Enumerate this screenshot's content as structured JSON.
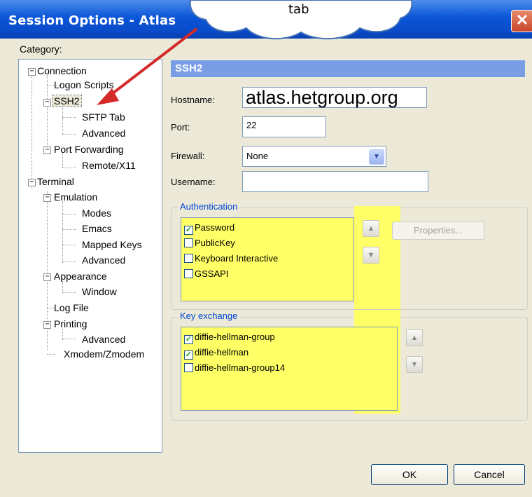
{
  "window": {
    "title": "Session Options - Atlas",
    "close_glyph": "✕"
  },
  "callout": {
    "text": "tab"
  },
  "category_label": "Category:",
  "tree": {
    "connection": "Connection",
    "logon_scripts": "Logon Scripts",
    "ssh2": "SSH2",
    "sftp_tab": "SFTP Tab",
    "advanced_ssh": "Advanced",
    "port_forwarding": "Port Forwarding",
    "remote_x11": "Remote/X11",
    "terminal": "Terminal",
    "emulation": "Emulation",
    "modes": "Modes",
    "emacs": "Emacs",
    "mapped_keys": "Mapped Keys",
    "advanced_emulation": "Advanced",
    "appearance": "Appearance",
    "window": "Window",
    "log_file": "Log File",
    "printing": "Printing",
    "advanced_printing": "Advanced",
    "xmodem": "Xmodem/Zmodem",
    "collapse_glyph": "−"
  },
  "panel": {
    "header": "SSH2",
    "hostname_label": "Hostname:",
    "hostname_value": "atlas.hetgroup.org",
    "port_label": "Port:",
    "port_value": "22",
    "firewall_label": "Firewall:",
    "firewall_value": "None",
    "username_label": "Username:",
    "username_value": ""
  },
  "authentication": {
    "title": "Authentication",
    "items": [
      {
        "label": "Password",
        "checked": true
      },
      {
        "label": "PublicKey",
        "checked": false
      },
      {
        "label": "Keyboard Interactive",
        "checked": false
      },
      {
        "label": "GSSAPI",
        "checked": false
      }
    ],
    "properties_label": "Properties..."
  },
  "key_exchange": {
    "title": "Key exchange",
    "items": [
      {
        "label": "diffie-hellman-group",
        "checked": true
      },
      {
        "label": "diffie-hellman",
        "checked": true
      },
      {
        "label": "diffie-hellman-group14",
        "checked": false
      }
    ]
  },
  "buttons": {
    "ok": "OK",
    "cancel": "Cancel"
  },
  "glyphs": {
    "up": "▲",
    "down": "▼",
    "check": "✓",
    "dropdown": "▼"
  },
  "colors": {
    "titlebar": "#0a55d8",
    "highlight": "#ffff66",
    "arrow": "#d42a2a",
    "section_header": "#7a9ee6"
  }
}
